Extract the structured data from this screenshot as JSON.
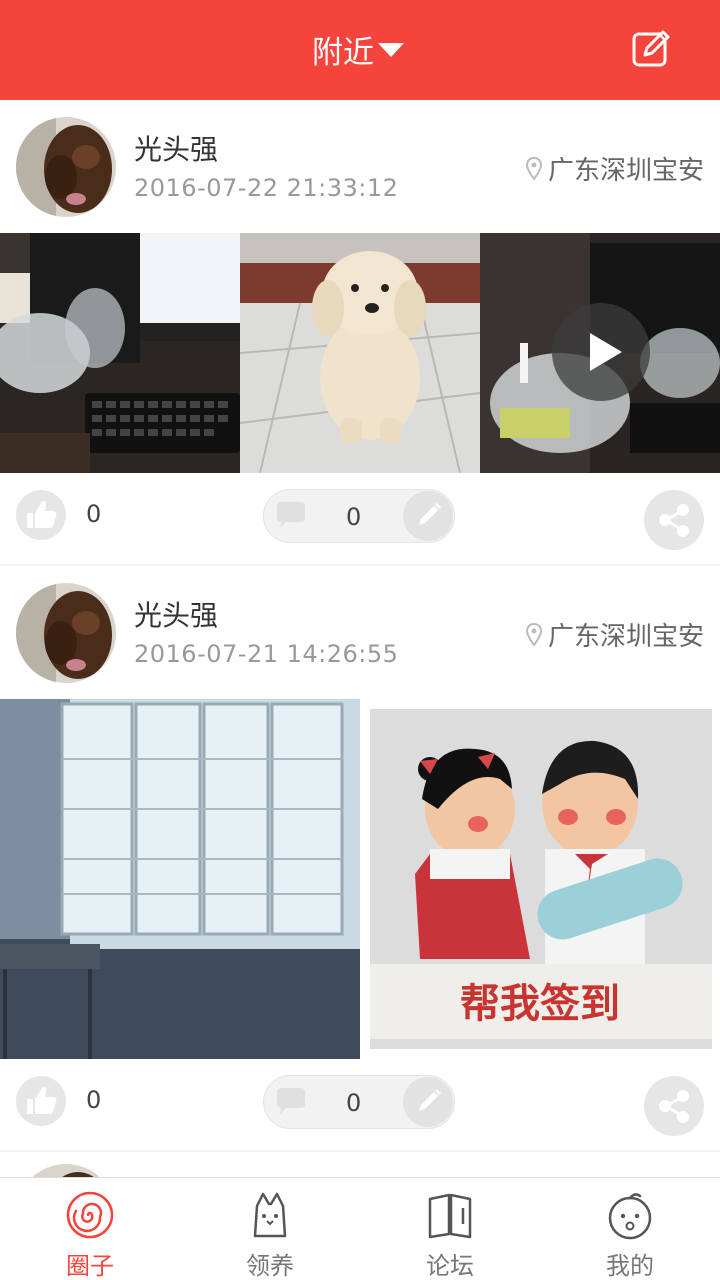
{
  "app": {
    "accent": "#f4443b"
  },
  "header": {
    "title": "附近",
    "edit_icon": "edit-icon"
  },
  "posts": [
    {
      "author": "光头强",
      "time": "2016-07-22 21:33:12",
      "location": "广东深圳宝安",
      "likes": "0",
      "comments": "0",
      "media": [
        "photo",
        "photo",
        "video"
      ]
    },
    {
      "author": "光头强",
      "time": "2016-07-21 14:26:55",
      "location": "广东深圳宝安",
      "likes": "0",
      "comments": "0",
      "media": [
        "photo",
        "image"
      ],
      "image_caption": "帮我签到"
    }
  ],
  "tabs": [
    {
      "label": "圈子",
      "icon": "circle-swirl-icon",
      "active": true
    },
    {
      "label": "领养",
      "icon": "adopt-bag-icon",
      "active": false
    },
    {
      "label": "论坛",
      "icon": "book-icon",
      "active": false
    },
    {
      "label": "我的",
      "icon": "baby-face-icon",
      "active": false
    }
  ]
}
